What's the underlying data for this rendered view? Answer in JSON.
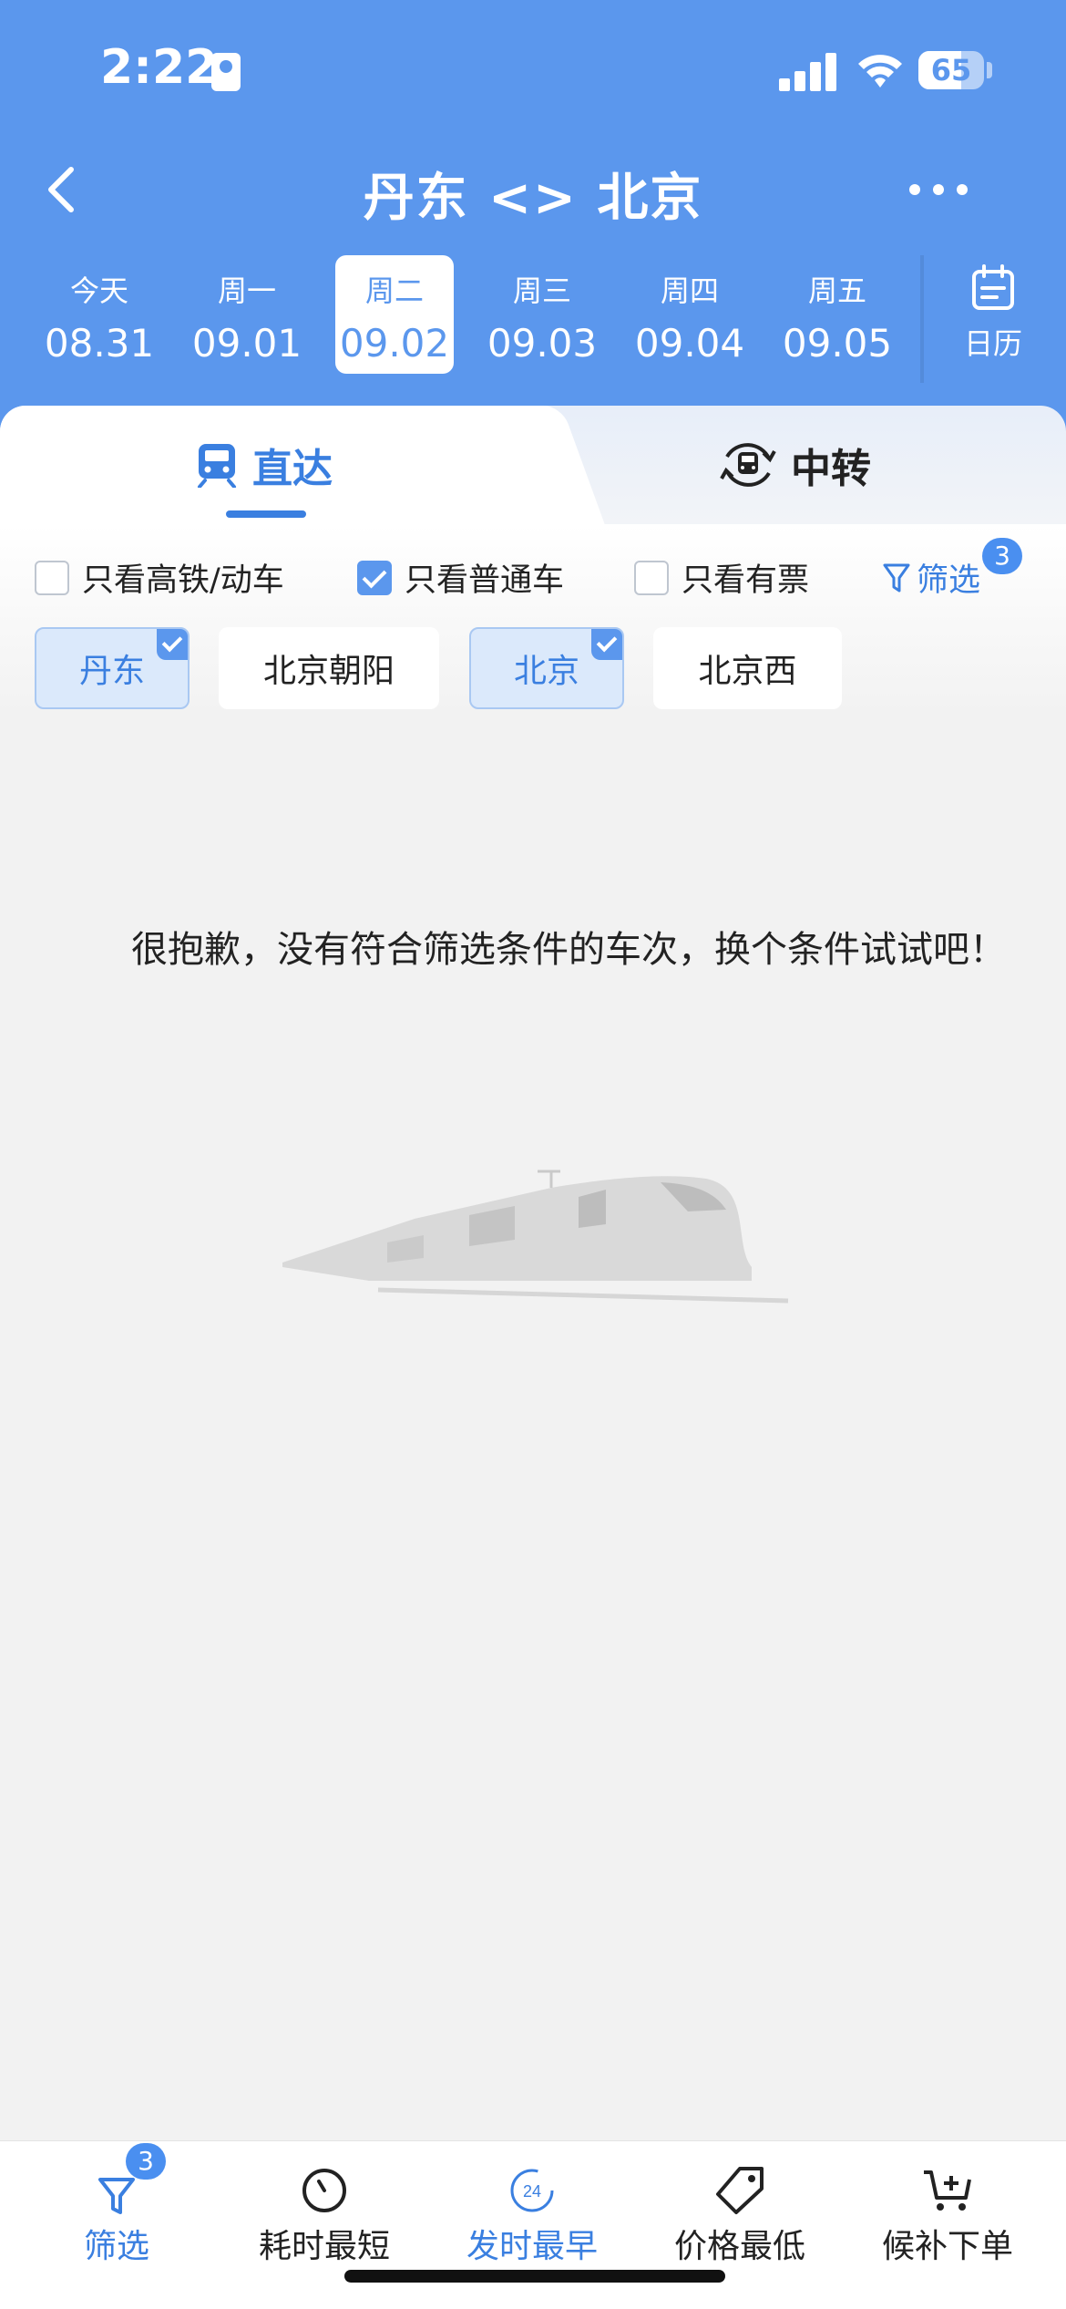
{
  "status_bar": {
    "time": "2:22",
    "battery": "65"
  },
  "nav": {
    "title": "丹东 <> 北京"
  },
  "dates": [
    {
      "weekday": "今天",
      "date": "08.31",
      "active": false
    },
    {
      "weekday": "周一",
      "date": "09.01",
      "active": false
    },
    {
      "weekday": "周二",
      "date": "09.02",
      "active": true
    },
    {
      "weekday": "周三",
      "date": "09.03",
      "active": false
    },
    {
      "weekday": "周四",
      "date": "09.04",
      "active": false
    },
    {
      "weekday": "周五",
      "date": "09.05",
      "active": false
    }
  ],
  "calendar": {
    "label": "日历"
  },
  "tabs": {
    "direct": "直达",
    "transfer": "中转"
  },
  "filters": {
    "high_speed": {
      "label": "只看高铁/动车",
      "checked": false
    },
    "normal": {
      "label": "只看普通车",
      "checked": true
    },
    "has_ticket": {
      "label": "只看有票",
      "checked": false
    },
    "filter_label": "筛选",
    "filter_count": "3"
  },
  "stations": [
    {
      "name": "丹东",
      "selected": true
    },
    {
      "name": "北京朝阳",
      "selected": false
    },
    {
      "name": "北京",
      "selected": true
    },
    {
      "name": "北京西",
      "selected": false
    }
  ],
  "empty_message": "很抱歉，没有符合筛选条件的车次，换个条件试试吧！",
  "bottom_bar": {
    "filter": {
      "label": "筛选",
      "badge": "3"
    },
    "shortest": {
      "label": "耗时最短"
    },
    "earliest": {
      "label": "发时最早",
      "icon_text": "24"
    },
    "cheapest": {
      "label": "价格最低"
    },
    "waitlist": {
      "label": "候补下单"
    }
  },
  "colors": {
    "primary": "#5b97ed",
    "accent": "#3a7fe0",
    "background": "#f2f2f2"
  }
}
